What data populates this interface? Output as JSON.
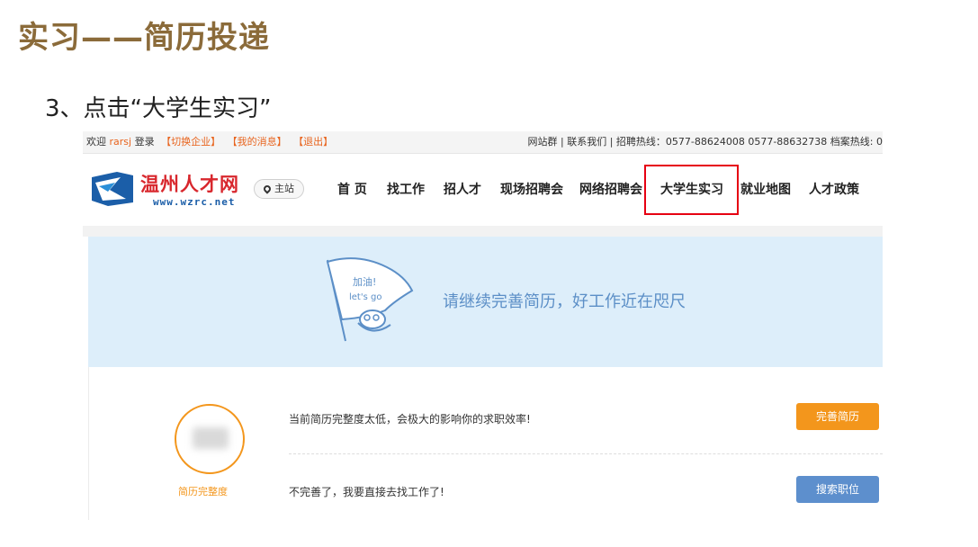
{
  "slide": {
    "title": "实习——简历投递",
    "step": "3、点击“大学生实习”"
  },
  "topbar": {
    "welcome": "欢迎",
    "username": "rarsj",
    "login": "登录",
    "switch_enterprise": "【切换企业】",
    "my_messages": "【我的消息】",
    "logout": "【退出】",
    "right_text": "网站群 | 联系我们 | 招聘热线：0577-88624008 0577-88632738 档案热线: 0"
  },
  "logo": {
    "name": "温州人才网",
    "url": "www.wzrc.net"
  },
  "site_switch": {
    "label": "主站",
    "icon": "location-pin-icon"
  },
  "nav": {
    "items": [
      "首 页",
      "找工作",
      "招人才",
      "现场招聘会",
      "网络招聘会",
      "大学生实习",
      "就业地图",
      "人才政策"
    ],
    "highlighted": "大学生实习"
  },
  "banner": {
    "flag_line1": "加油!",
    "flag_line2": "let's go",
    "message": "请继续完善简历，好工作近在咫尺"
  },
  "resume": {
    "completeness_label": "简历完整度",
    "row1_text": "当前简历完整度太低，会极大的影响你的求职效率!",
    "row1_button": "完善简历",
    "row2_text": "不完善了，我要直接去找工作了!",
    "row2_button": "搜索职位"
  },
  "colors": {
    "title_brown": "#8B6B3A",
    "highlight_red": "#e60012",
    "orange": "#f3961c",
    "blue_button": "#5d8fcd",
    "banner_bg": "#ddeefa",
    "logo_red": "#d8272d"
  }
}
